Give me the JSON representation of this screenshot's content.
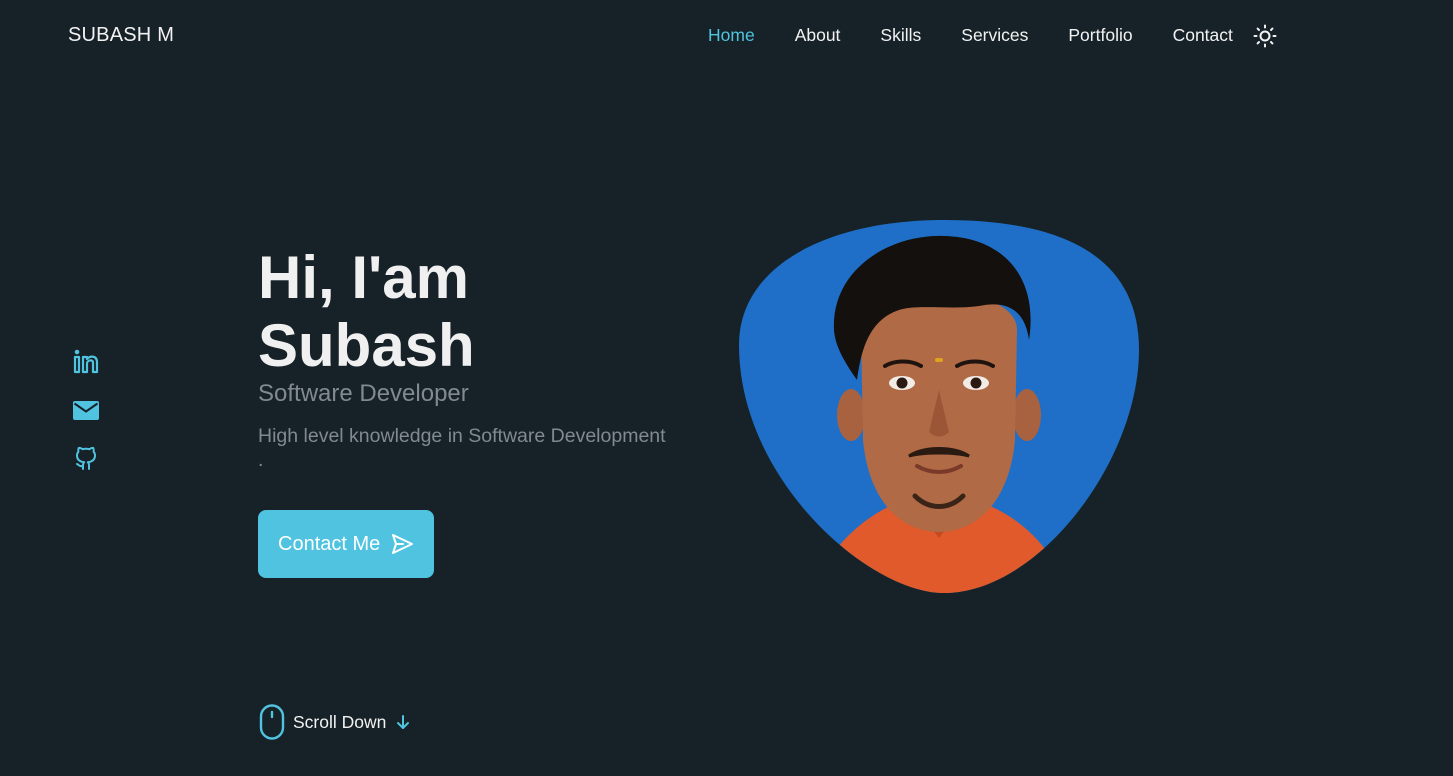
{
  "header": {
    "logo": "SUBASH M",
    "nav": [
      {
        "label": "Home",
        "active": true
      },
      {
        "label": "About"
      },
      {
        "label": "Skills"
      },
      {
        "label": "Services"
      },
      {
        "label": "Portfolio"
      },
      {
        "label": "Contact"
      }
    ],
    "theme_icon": "sun-icon"
  },
  "socials": [
    "linkedin-icon",
    "mail-icon",
    "github-icon"
  ],
  "hero": {
    "greeting": "Hi, I'am",
    "name": "Subash",
    "subtitle": "Software Developer",
    "description": "High level knowledge in Software Development",
    "description_tail": ".",
    "cta_label": "Contact Me",
    "cta_icon": "send-icon"
  },
  "scroll": {
    "label": "Scroll Down",
    "icon": "mouse-icon",
    "arrow_icon": "arrow-down-icon"
  },
  "colors": {
    "background": "#172228",
    "accent": "#4fc3df",
    "muted_text": "#808a8f",
    "photo_background": "#1f6fc8"
  }
}
